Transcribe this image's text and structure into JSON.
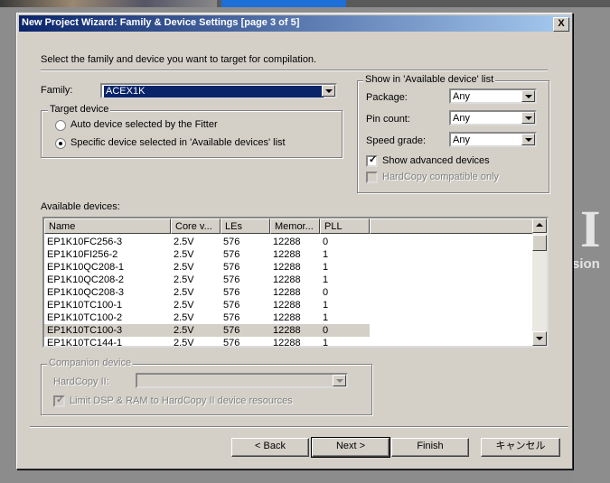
{
  "window": {
    "title": "New Project Wizard: Family & Device Settings [page 3 of 5]",
    "close_label": "X"
  },
  "intro": "Select the family and device you want to target for compilation.",
  "family": {
    "label": "Family:",
    "value": "ACEX1K"
  },
  "target_device": {
    "group_label": "Target device",
    "options": [
      {
        "label": "Auto device selected by the Fitter",
        "selected": false
      },
      {
        "label": "Specific device selected in 'Available devices' list",
        "selected": true
      }
    ]
  },
  "filters": {
    "group_label": "Show in 'Available device' list",
    "package": {
      "label": "Package:",
      "value": "Any"
    },
    "pin_count": {
      "label": "Pin count:",
      "value": "Any"
    },
    "speed_grade": {
      "label": "Speed grade:",
      "value": "Any"
    },
    "show_advanced": {
      "label": "Show advanced devices",
      "checked": true
    },
    "hardcopy_compatible": {
      "label": "HardCopy compatible only",
      "checked": false,
      "enabled": false
    }
  },
  "available_devices": {
    "label": "Available devices:",
    "columns": [
      "Name",
      "Core v...",
      "LEs",
      "Memor...",
      "PLL"
    ],
    "rows": [
      [
        "EP1K10FC256-3",
        "2.5V",
        "576",
        "12288",
        "0"
      ],
      [
        "EP1K10FI256-2",
        "2.5V",
        "576",
        "12288",
        "1"
      ],
      [
        "EP1K10QC208-1",
        "2.5V",
        "576",
        "12288",
        "1"
      ],
      [
        "EP1K10QC208-2",
        "2.5V",
        "576",
        "12288",
        "1"
      ],
      [
        "EP1K10QC208-3",
        "2.5V",
        "576",
        "12288",
        "0"
      ],
      [
        "EP1K10TC100-1",
        "2.5V",
        "576",
        "12288",
        "1"
      ],
      [
        "EP1K10TC100-2",
        "2.5V",
        "576",
        "12288",
        "1"
      ],
      [
        "EP1K10TC100-3",
        "2.5V",
        "576",
        "12288",
        "0"
      ],
      [
        "EP1K10TC144-1",
        "2.5V",
        "576",
        "12288",
        "1"
      ]
    ],
    "selected_row": 7
  },
  "companion": {
    "group_label": "Companion device",
    "hardcopy_label": "HardCopy II:",
    "hardcopy_value": "",
    "limit_label": "Limit DSP & RAM to HardCopy II device resources",
    "limit_checked": true
  },
  "buttons": {
    "back": "< Back",
    "next": "Next >",
    "finish": "Finish",
    "cancel": "キャンセル"
  },
  "background": {
    "big_letter": "I",
    "fragment": "sion"
  }
}
